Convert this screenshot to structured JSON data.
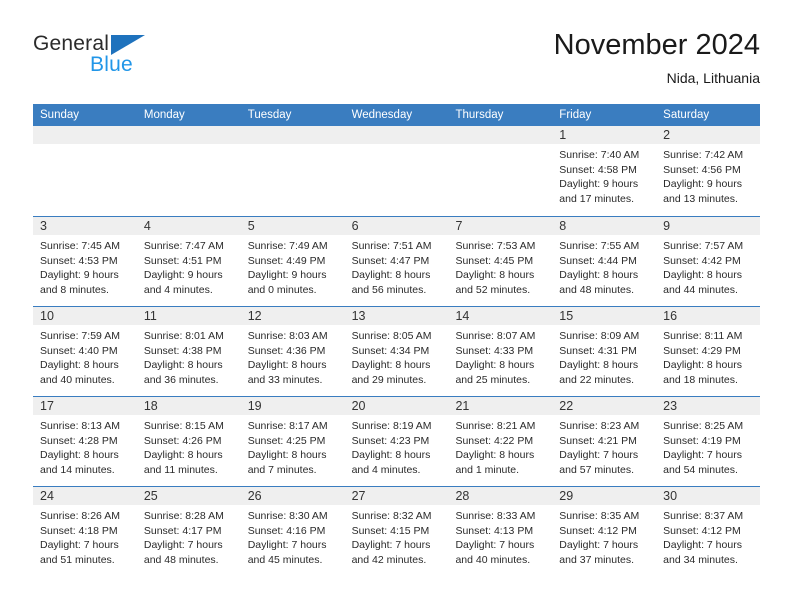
{
  "brand": {
    "name_part1": "General",
    "name_part2": "Blue",
    "triangle_color": "#1e72bd",
    "blue_color": "#2196e8"
  },
  "header": {
    "title": "November 2024",
    "subtitle": "Nida, Lithuania"
  },
  "theme": {
    "header_blue": "#3a7dc0",
    "day_band_gray": "#efefef",
    "text": "#2a2a2a"
  },
  "weekdays": [
    "Sunday",
    "Monday",
    "Tuesday",
    "Wednesday",
    "Thursday",
    "Friday",
    "Saturday"
  ],
  "weeks": [
    [
      {
        "day": "",
        "empty": true,
        "sunrise": "",
        "sunset": "",
        "daylight1": "",
        "daylight2": ""
      },
      {
        "day": "",
        "empty": true,
        "sunrise": "",
        "sunset": "",
        "daylight1": "",
        "daylight2": ""
      },
      {
        "day": "",
        "empty": true,
        "sunrise": "",
        "sunset": "",
        "daylight1": "",
        "daylight2": ""
      },
      {
        "day": "",
        "empty": true,
        "sunrise": "",
        "sunset": "",
        "daylight1": "",
        "daylight2": ""
      },
      {
        "day": "",
        "empty": true,
        "sunrise": "",
        "sunset": "",
        "daylight1": "",
        "daylight2": ""
      },
      {
        "day": "1",
        "empty": false,
        "sunrise": "Sunrise: 7:40 AM",
        "sunset": "Sunset: 4:58 PM",
        "daylight1": "Daylight: 9 hours",
        "daylight2": "and 17 minutes."
      },
      {
        "day": "2",
        "empty": false,
        "sunrise": "Sunrise: 7:42 AM",
        "sunset": "Sunset: 4:56 PM",
        "daylight1": "Daylight: 9 hours",
        "daylight2": "and 13 minutes."
      }
    ],
    [
      {
        "day": "3",
        "empty": false,
        "sunrise": "Sunrise: 7:45 AM",
        "sunset": "Sunset: 4:53 PM",
        "daylight1": "Daylight: 9 hours",
        "daylight2": "and 8 minutes."
      },
      {
        "day": "4",
        "empty": false,
        "sunrise": "Sunrise: 7:47 AM",
        "sunset": "Sunset: 4:51 PM",
        "daylight1": "Daylight: 9 hours",
        "daylight2": "and 4 minutes."
      },
      {
        "day": "5",
        "empty": false,
        "sunrise": "Sunrise: 7:49 AM",
        "sunset": "Sunset: 4:49 PM",
        "daylight1": "Daylight: 9 hours",
        "daylight2": "and 0 minutes."
      },
      {
        "day": "6",
        "empty": false,
        "sunrise": "Sunrise: 7:51 AM",
        "sunset": "Sunset: 4:47 PM",
        "daylight1": "Daylight: 8 hours",
        "daylight2": "and 56 minutes."
      },
      {
        "day": "7",
        "empty": false,
        "sunrise": "Sunrise: 7:53 AM",
        "sunset": "Sunset: 4:45 PM",
        "daylight1": "Daylight: 8 hours",
        "daylight2": "and 52 minutes."
      },
      {
        "day": "8",
        "empty": false,
        "sunrise": "Sunrise: 7:55 AM",
        "sunset": "Sunset: 4:44 PM",
        "daylight1": "Daylight: 8 hours",
        "daylight2": "and 48 minutes."
      },
      {
        "day": "9",
        "empty": false,
        "sunrise": "Sunrise: 7:57 AM",
        "sunset": "Sunset: 4:42 PM",
        "daylight1": "Daylight: 8 hours",
        "daylight2": "and 44 minutes."
      }
    ],
    [
      {
        "day": "10",
        "empty": false,
        "sunrise": "Sunrise: 7:59 AM",
        "sunset": "Sunset: 4:40 PM",
        "daylight1": "Daylight: 8 hours",
        "daylight2": "and 40 minutes."
      },
      {
        "day": "11",
        "empty": false,
        "sunrise": "Sunrise: 8:01 AM",
        "sunset": "Sunset: 4:38 PM",
        "daylight1": "Daylight: 8 hours",
        "daylight2": "and 36 minutes."
      },
      {
        "day": "12",
        "empty": false,
        "sunrise": "Sunrise: 8:03 AM",
        "sunset": "Sunset: 4:36 PM",
        "daylight1": "Daylight: 8 hours",
        "daylight2": "and 33 minutes."
      },
      {
        "day": "13",
        "empty": false,
        "sunrise": "Sunrise: 8:05 AM",
        "sunset": "Sunset: 4:34 PM",
        "daylight1": "Daylight: 8 hours",
        "daylight2": "and 29 minutes."
      },
      {
        "day": "14",
        "empty": false,
        "sunrise": "Sunrise: 8:07 AM",
        "sunset": "Sunset: 4:33 PM",
        "daylight1": "Daylight: 8 hours",
        "daylight2": "and 25 minutes."
      },
      {
        "day": "15",
        "empty": false,
        "sunrise": "Sunrise: 8:09 AM",
        "sunset": "Sunset: 4:31 PM",
        "daylight1": "Daylight: 8 hours",
        "daylight2": "and 22 minutes."
      },
      {
        "day": "16",
        "empty": false,
        "sunrise": "Sunrise: 8:11 AM",
        "sunset": "Sunset: 4:29 PM",
        "daylight1": "Daylight: 8 hours",
        "daylight2": "and 18 minutes."
      }
    ],
    [
      {
        "day": "17",
        "empty": false,
        "sunrise": "Sunrise: 8:13 AM",
        "sunset": "Sunset: 4:28 PM",
        "daylight1": "Daylight: 8 hours",
        "daylight2": "and 14 minutes."
      },
      {
        "day": "18",
        "empty": false,
        "sunrise": "Sunrise: 8:15 AM",
        "sunset": "Sunset: 4:26 PM",
        "daylight1": "Daylight: 8 hours",
        "daylight2": "and 11 minutes."
      },
      {
        "day": "19",
        "empty": false,
        "sunrise": "Sunrise: 8:17 AM",
        "sunset": "Sunset: 4:25 PM",
        "daylight1": "Daylight: 8 hours",
        "daylight2": "and 7 minutes."
      },
      {
        "day": "20",
        "empty": false,
        "sunrise": "Sunrise: 8:19 AM",
        "sunset": "Sunset: 4:23 PM",
        "daylight1": "Daylight: 8 hours",
        "daylight2": "and 4 minutes."
      },
      {
        "day": "21",
        "empty": false,
        "sunrise": "Sunrise: 8:21 AM",
        "sunset": "Sunset: 4:22 PM",
        "daylight1": "Daylight: 8 hours",
        "daylight2": "and 1 minute."
      },
      {
        "day": "22",
        "empty": false,
        "sunrise": "Sunrise: 8:23 AM",
        "sunset": "Sunset: 4:21 PM",
        "daylight1": "Daylight: 7 hours",
        "daylight2": "and 57 minutes."
      },
      {
        "day": "23",
        "empty": false,
        "sunrise": "Sunrise: 8:25 AM",
        "sunset": "Sunset: 4:19 PM",
        "daylight1": "Daylight: 7 hours",
        "daylight2": "and 54 minutes."
      }
    ],
    [
      {
        "day": "24",
        "empty": false,
        "sunrise": "Sunrise: 8:26 AM",
        "sunset": "Sunset: 4:18 PM",
        "daylight1": "Daylight: 7 hours",
        "daylight2": "and 51 minutes."
      },
      {
        "day": "25",
        "empty": false,
        "sunrise": "Sunrise: 8:28 AM",
        "sunset": "Sunset: 4:17 PM",
        "daylight1": "Daylight: 7 hours",
        "daylight2": "and 48 minutes."
      },
      {
        "day": "26",
        "empty": false,
        "sunrise": "Sunrise: 8:30 AM",
        "sunset": "Sunset: 4:16 PM",
        "daylight1": "Daylight: 7 hours",
        "daylight2": "and 45 minutes."
      },
      {
        "day": "27",
        "empty": false,
        "sunrise": "Sunrise: 8:32 AM",
        "sunset": "Sunset: 4:15 PM",
        "daylight1": "Daylight: 7 hours",
        "daylight2": "and 42 minutes."
      },
      {
        "day": "28",
        "empty": false,
        "sunrise": "Sunrise: 8:33 AM",
        "sunset": "Sunset: 4:13 PM",
        "daylight1": "Daylight: 7 hours",
        "daylight2": "and 40 minutes."
      },
      {
        "day": "29",
        "empty": false,
        "sunrise": "Sunrise: 8:35 AM",
        "sunset": "Sunset: 4:12 PM",
        "daylight1": "Daylight: 7 hours",
        "daylight2": "and 37 minutes."
      },
      {
        "day": "30",
        "empty": false,
        "sunrise": "Sunrise: 8:37 AM",
        "sunset": "Sunset: 4:12 PM",
        "daylight1": "Daylight: 7 hours",
        "daylight2": "and 34 minutes."
      }
    ]
  ]
}
